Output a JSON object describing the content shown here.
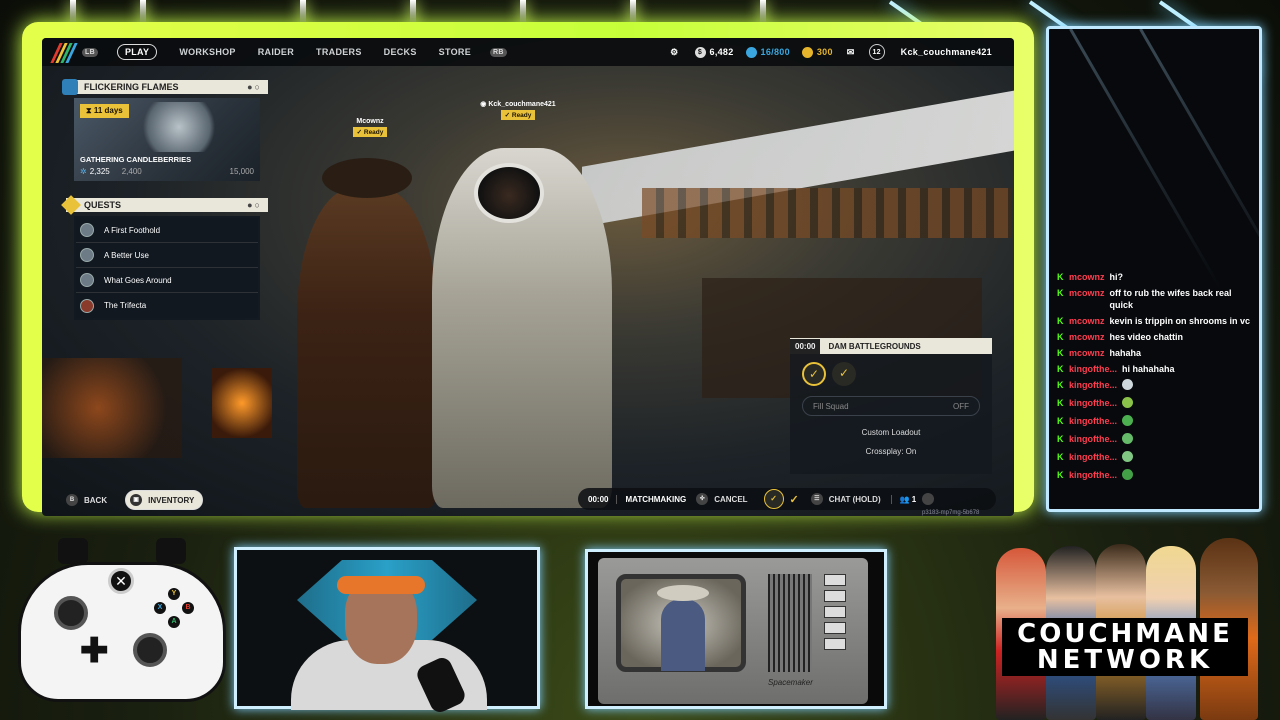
{
  "topbar": {
    "lb": "LB",
    "rb": "RB",
    "nav": [
      "PLAY",
      "WORKSHOP",
      "RAIDER",
      "TRADERS",
      "DECKS",
      "STORE"
    ],
    "currency1": "6,482",
    "currency2": "16/800",
    "currency3": "300",
    "level": "12",
    "username": "Kck_couchmane421"
  },
  "event": {
    "title": "FLICKERING FLAMES",
    "days": "11 days",
    "name": "GATHERING CANDLEBERRIES",
    "progress": "2,325",
    "mid": "2,400",
    "max": "15,000"
  },
  "quests": {
    "title": "QUESTS",
    "items": [
      "A First Foothold",
      "A Better Use",
      "What Goes Around",
      "The Trifecta"
    ]
  },
  "players": [
    {
      "name": "Mcownz",
      "status": "Ready"
    },
    {
      "name": "Kck_couchmane421",
      "status": "Ready"
    }
  ],
  "squad": {
    "timer": "00:00",
    "map": "DAM BATTLEGROUNDS",
    "fill_label": "Fill Squad",
    "fill_value": "OFF",
    "loadout": "Custom Loadout",
    "crossplay": "Crossplay: On"
  },
  "bottom": {
    "back": "BACK",
    "inventory": "INVENTORY",
    "timer": "00:00",
    "matchmaking": "MATCHMAKING",
    "cancel": "CANCEL",
    "chat": "CHAT (HOLD)",
    "count": "1",
    "build": "p3183-mp7mg-5b678",
    "key_back": "B"
  },
  "chat": [
    {
      "user": "mcownz",
      "text": "hi?"
    },
    {
      "user": "mcownz",
      "text": "off to rub the wifes back real quick"
    },
    {
      "user": "mcownz",
      "text": "kevin is trippin on shrooms in vc"
    },
    {
      "user": "mcownz",
      "text": "hes video chattin"
    },
    {
      "user": "mcownz",
      "text": "hahaha"
    },
    {
      "user": "kingofthe...",
      "text": "hi hahahaha"
    },
    {
      "user": "kingofthe...",
      "text": "",
      "emote": "#cfd8dc"
    },
    {
      "user": "kingofthe...",
      "text": "",
      "emote": "#8bc34a"
    },
    {
      "user": "kingofthe...",
      "text": "",
      "emote": "#4caf50"
    },
    {
      "user": "kingofthe...",
      "text": "",
      "emote": "#66bb6a"
    },
    {
      "user": "kingofthe...",
      "text": "",
      "emote": "#81c784"
    },
    {
      "user": "kingofthe...",
      "text": "",
      "emote": "#43a047"
    }
  ],
  "controller": {
    "buttons": [
      "Y",
      "X",
      "B",
      "A"
    ]
  },
  "brand": {
    "line1": "COUCHMANE",
    "line2": "NETWORK"
  },
  "tv": {
    "brand": "Spacemaker"
  },
  "colors": {
    "accent": "#d6ff45",
    "chat_user": "#ff3d4f",
    "kick_green": "#53fc18"
  }
}
